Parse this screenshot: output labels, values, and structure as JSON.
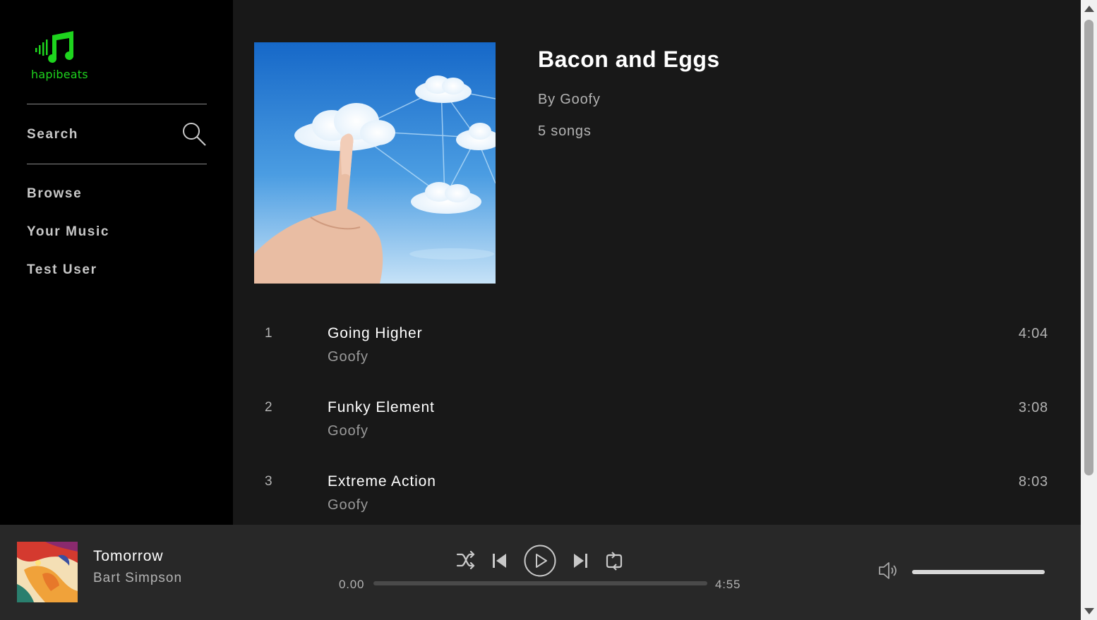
{
  "brand": {
    "name": "hapibeats",
    "logo_icon": "music-note-signal-icon",
    "accent_color": "#1ed41e"
  },
  "sidebar": {
    "search_label": "Search",
    "search_icon": "search-icon",
    "items": [
      {
        "label": "Browse"
      },
      {
        "label": "Your Music"
      },
      {
        "label": "Test User"
      }
    ]
  },
  "album": {
    "title": "Bacon and Eggs",
    "by": "By Goofy",
    "count": "5 songs",
    "cover_description": "cloud-computing-cover"
  },
  "tracks": [
    {
      "num": "1",
      "title": "Going Higher",
      "artist": "Goofy",
      "duration": "4:04"
    },
    {
      "num": "2",
      "title": "Funky Element",
      "artist": "Goofy",
      "duration": "3:08"
    },
    {
      "num": "3",
      "title": "Extreme Action",
      "artist": "Goofy",
      "duration": "8:03"
    }
  ],
  "player": {
    "title": "Tomorrow",
    "artist": "Bart Simpson",
    "current_time": "0.00",
    "total_time": "4:55",
    "progress": 0,
    "volume": 1.0,
    "controls": [
      "shuffle-icon",
      "previous-icon",
      "play-icon",
      "next-icon",
      "repeat-icon"
    ],
    "volume_icon": "speaker-icon"
  }
}
